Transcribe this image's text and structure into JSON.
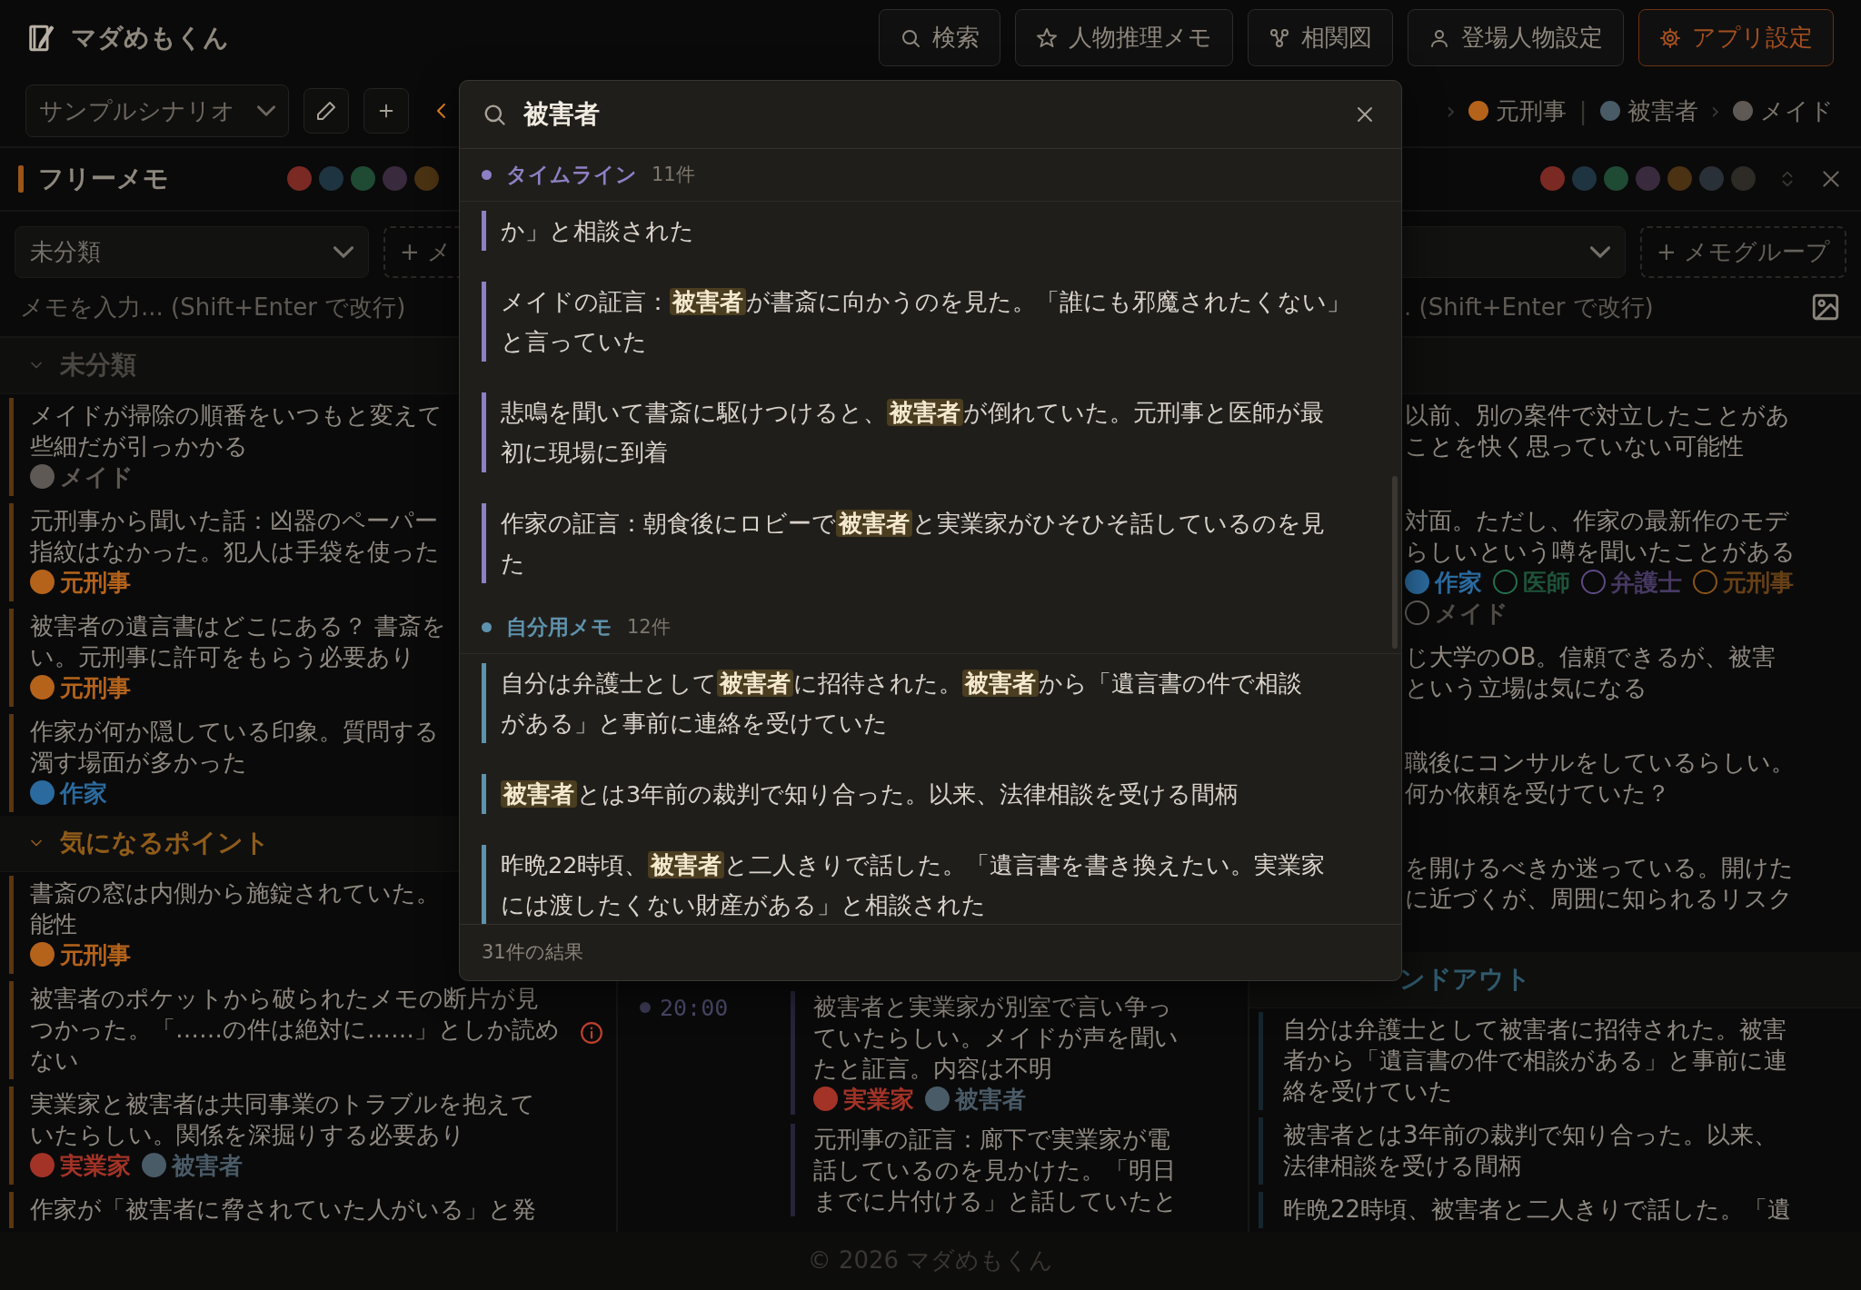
{
  "app": {
    "title": "マダめもくん"
  },
  "nav_buttons": [
    {
      "label": "検索",
      "kind": "search",
      "highlighted": false
    },
    {
      "label": "人物推理メモ",
      "kind": "star",
      "highlighted": false
    },
    {
      "label": "相関図",
      "kind": "nodes",
      "highlighted": false
    },
    {
      "label": "登場人物設定",
      "kind": "person",
      "highlighted": false
    },
    {
      "label": "アプリ設定",
      "kind": "gear",
      "highlighted": true
    }
  ],
  "scenario_bar": {
    "scenario": "サンプルシナリオ",
    "chain": [
      {
        "separator": "›",
        "name": "元刑事",
        "color": "#b5631b"
      },
      {
        "separator": "|",
        "name": "被害者",
        "color": "#4a5b68"
      },
      {
        "separator": "›",
        "name": "メイド",
        "color": "#5f5955"
      }
    ]
  },
  "left_panel": {
    "title": "フリーメモ",
    "filters": [
      {
        "color": "#7a2a22"
      },
      {
        "color": "#1e3440"
      },
      {
        "color": "#1f4a34"
      },
      {
        "color": "#3a2a3e"
      },
      {
        "color": "#4a3212"
      }
    ],
    "group_select": "未分類",
    "add_group": "+ メ",
    "placeholder": "メモを入力... (Shift+Enter で改行)",
    "sections": [
      {
        "title": "未分類",
        "color": "#4a4641",
        "expanded": true,
        "memos": [
          {
            "lines": [
              "メイドが掃除の順番をいつもと変えて",
              "些細だが引っかかる"
            ],
            "alert": false,
            "tags": [
              {
                "name": "メイド",
                "color": "#5f5955"
              }
            ]
          },
          {
            "lines": [
              "元刑事から聞いた話：凶器のペーパー",
              "指紋はなかった。犯人は手袋を使った"
            ],
            "alert": false,
            "tags": [
              {
                "name": "元刑事",
                "color": "#b5631b"
              }
            ]
          },
          {
            "lines": [
              "被害者の遺言書はどこにある？ 書斎を",
              "い。元刑事に許可をもらう必要あり"
            ],
            "alert": false,
            "tags": [
              {
                "name": "元刑事",
                "color": "#b5631b"
              }
            ]
          },
          {
            "lines": [
              "作家が何か隠している印象。質問する",
              "濁す場面が多かった"
            ],
            "alert": false,
            "tags": [
              {
                "name": "作家",
                "color": "#2b6a9e"
              }
            ]
          }
        ]
      },
      {
        "title": "気になるポイント",
        "color": "#8f5c1a",
        "expanded": true,
        "memos": [
          {
            "lines": [
              "書斎の窓は内側から施錠されていた。",
              "能性"
            ],
            "alert": false,
            "tags": [
              {
                "name": "元刑事",
                "color": "#b5631b"
              }
            ]
          },
          {
            "lines": [
              "被害者のポケットから破られたメモの断片が見",
              "つかった。「……の件は絶対に……」としか読め",
              "ない"
            ],
            "alert": true
          },
          {
            "lines": [
              "実業家と被害者は共同事業のトラブルを抱えて",
              "いたらしい。関係を深掘りする必要あり"
            ],
            "alert": false,
            "tags": [
              {
                "name": "実業家",
                "color": "#a33327"
              },
              {
                "name": "被害者",
                "color": "#4a5b68"
              }
            ]
          },
          {
            "lines": [
              "作家が「被害者に脅されていた人がいる」と発"
            ],
            "alert": false
          }
        ]
      }
    ]
  },
  "timeline": {
    "entries": [
      {
        "time": "20:00",
        "items": [
          {
            "lines": [
              "被害者と実業家が別室で言い争っ",
              "ていたらしい。メイドが声を聞い",
              "たと証言。内容は不明"
            ],
            "tags": [
              {
                "name": "実業家",
                "color": "#a33327"
              },
              {
                "name": "被害者",
                "color": "#4a5b68"
              }
            ]
          },
          {
            "lines": [
              "元刑事の証言：廊下で実業家が電",
              "話しているのを見かけた。「明日",
              "までに片付ける」と話していたと"
            ]
          }
        ]
      }
    ]
  },
  "right_panel": {
    "filters": [
      {
        "color": "#7a2a22"
      },
      {
        "color": "#1e3440"
      },
      {
        "color": "#1f4a34"
      },
      {
        "color": "#3a2a3e"
      },
      {
        "color": "#4a3212"
      },
      {
        "color": "#2a3038"
      },
      {
        "color": "#2e2a26"
      }
    ],
    "add_group": "+ メモグループ",
    "placeholder": ". (Shift+Enter で改行)",
    "memos": [
      {
        "lines": [
          "以前、別の案件で対立したことがあ",
          "ことを快く思っていない可能性"
        ]
      },
      {
        "lines": [
          "対面。ただし、作家の最新作のモデ",
          "らしいという噂を聞いたことがある"
        ],
        "tags": [
          {
            "name": "作家",
            "color": "#2b6a9e",
            "selected": true
          },
          {
            "name": "医師",
            "color": "#24704c",
            "selected": false
          },
          {
            "name": "弁護士",
            "color": "#5e4a86",
            "selected": false
          },
          {
            "name": "元刑事",
            "color": "#8a5418",
            "selected": false
          },
          {
            "name": "メイド",
            "color": "#6a645e",
            "selected": false
          }
        ]
      },
      {
        "lines": [
          "じ大学のOB。信頼できるが、被害",
          "という立場は気になる"
        ]
      },
      {
        "lines": [
          "職後にコンサルをしているらしい。",
          "何か依頼を受けていた？"
        ]
      },
      {
        "lines": [
          "を開けるべきか迷っている。開けた",
          "に近づくが、周囲に知られるリスク"
        ]
      }
    ],
    "handout": {
      "title": "ンドアウト",
      "memos": [
        {
          "lines": [
            "自分は弁護士として被害者に招待された。被害",
            "者から「遺言書の件で相談がある」と事前に連",
            "絡を受けていた"
          ]
        },
        {
          "lines": [
            "被害者とは3年前の裁判で知り合った。以来、",
            "法律相談を受ける間柄"
          ]
        },
        {
          "lines": [
            "昨晩22時頃、被害者と二人きりで話した。「遺"
          ]
        }
      ]
    }
  },
  "search_modal": {
    "query": "被害者",
    "groups": [
      {
        "title": "タイムライン",
        "count": "11件",
        "color": "#8f7fc4",
        "results": [
          {
            "lines": [
              "か」と相談された"
            ]
          },
          {
            "lines": [
              "メイドの証言：**被害者**が書斎に向かうのを見た。「誰にも邪魔されたくない」",
              "と言っていた"
            ]
          },
          {
            "lines": [
              "悲鳴を聞いて書斎に駆けつけると、**被害者**が倒れていた。元刑事と医師が最",
              "初に現場に到着"
            ]
          },
          {
            "lines": [
              "作家の証言：朝食後にロビーで**被害者**と実業家がひそひそ話しているのを見",
              "た"
            ]
          }
        ]
      },
      {
        "title": "自分用メモ",
        "count": "12件",
        "color": "#5e93ad",
        "results": [
          {
            "lines": [
              "自分は弁護士として**被害者**に招待された。**被害者**から「遺言書の件で相談",
              "がある」と事前に連絡を受けていた"
            ]
          },
          {
            "lines": [
              "**被害者**とは3年前の裁判で知り合った。以来、法律相談を受ける間柄"
            ]
          },
          {
            "lines": [
              "昨晩22時頃、**被害者**と二人きりで話した。「遺言書を書き換えたい。実業家",
              "には渡したくない財産がある」と相談された"
            ]
          }
        ]
      }
    ],
    "summary": "31件の結果"
  },
  "footer": "© 2026 マダめもくん"
}
